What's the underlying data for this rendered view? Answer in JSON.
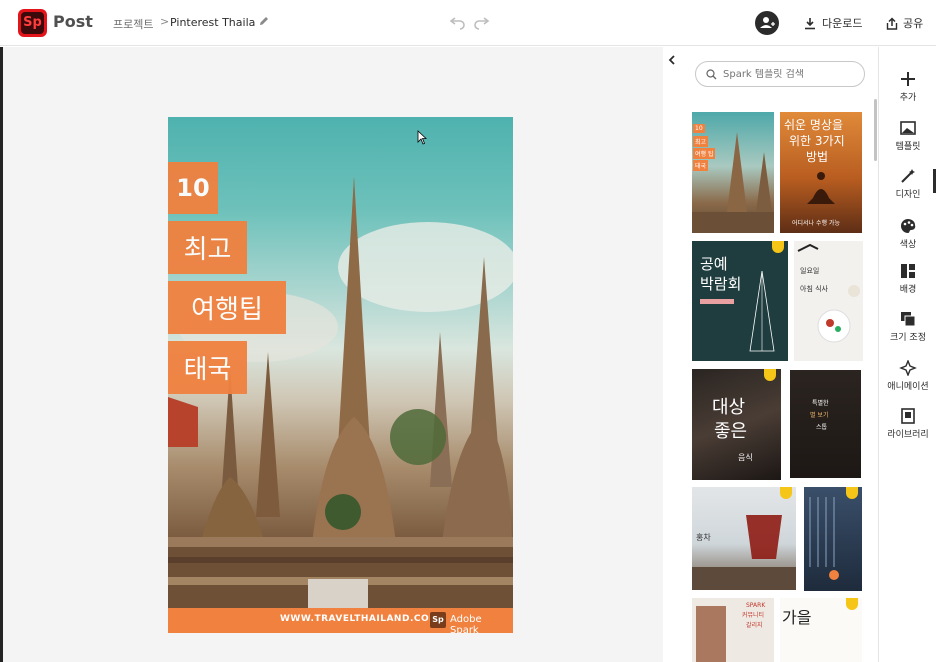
{
  "header": {
    "logo_text": "Sp",
    "app_name": "Post",
    "breadcrumb_project": "프로젝트",
    "breadcrumb_separator": ">",
    "document_title": "Pinterest Thailand ti",
    "download_label": "다운로드",
    "share_label": "공유"
  },
  "poster": {
    "badge_number": "10",
    "line1": "최고",
    "line2": "여행팁",
    "line3": "태국",
    "footer_url": "WWW.TRAVELTHAILAND.COM",
    "footer_mark": "Sp",
    "footer_brand": "Adobe Spark"
  },
  "templates_panel": {
    "search_placeholder": "Spark 템플릿 검색",
    "items": [
      {
        "lines": [
          "10",
          "최고",
          "여행 팁",
          "태국"
        ]
      },
      {
        "lines": [
          "쉬운 명상을",
          "위한 3가지",
          "방법",
          "어디서나 수행 가능"
        ]
      },
      {
        "lines": [
          "공예",
          "박람회"
        ]
      },
      {
        "lines": [
          "일요일",
          "아침 식사"
        ]
      },
      {
        "lines": [
          "대상",
          "좋은",
          "음식"
        ]
      },
      {
        "lines": [
          "특별한",
          "별 보기",
          "스톱"
        ]
      },
      {
        "lines": [
          "홍차"
        ]
      },
      {
        "lines": []
      },
      {
        "lines": [
          "SPARK",
          "커뮤니티",
          "갈리지"
        ]
      },
      {
        "lines": [
          "가을"
        ]
      }
    ]
  },
  "rail": {
    "items": [
      {
        "label": "추가",
        "icon": "plus-icon"
      },
      {
        "label": "템플릿",
        "icon": "template-icon"
      },
      {
        "label": "디자인",
        "icon": "magic-wand-icon"
      },
      {
        "label": "색상",
        "icon": "palette-icon"
      },
      {
        "label": "배경",
        "icon": "layout-icon"
      },
      {
        "label": "크기 조정",
        "icon": "resize-icon"
      },
      {
        "label": "애니메이션",
        "icon": "sparkle-icon"
      },
      {
        "label": "라이브러리",
        "icon": "library-icon"
      }
    ]
  },
  "colors": {
    "brand_red": "#e4141b",
    "poster_orange": "#f0813f",
    "premium_badge": "#f5c518"
  }
}
